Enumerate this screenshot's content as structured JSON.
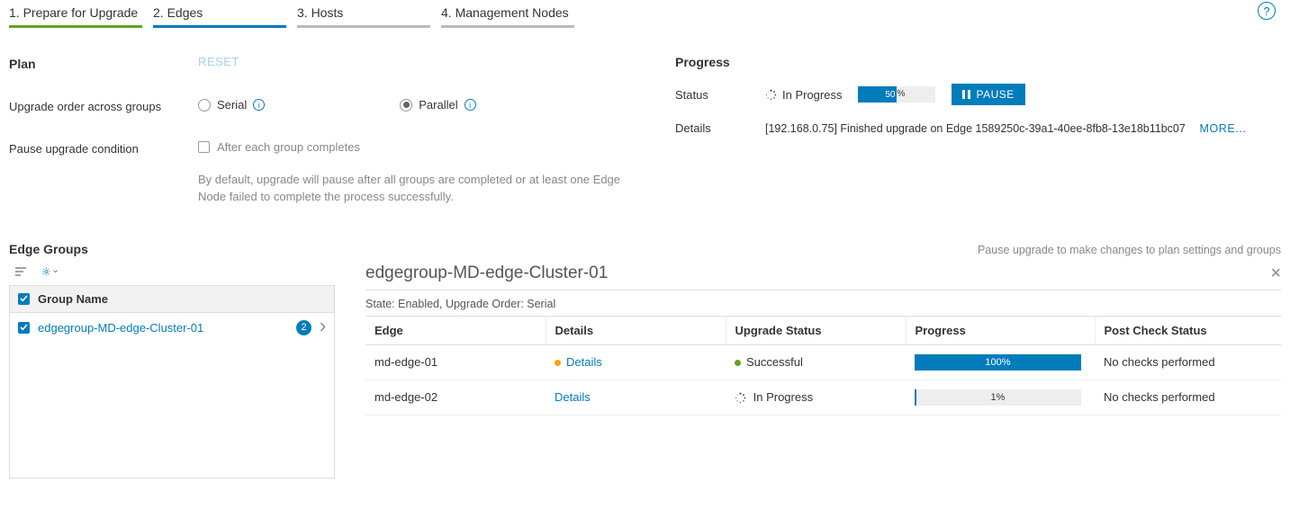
{
  "tabs": [
    {
      "label": "1. Prepare for Upgrade",
      "state": "done"
    },
    {
      "label": "2. Edges",
      "state": "active"
    },
    {
      "label": "3. Hosts",
      "state": ""
    },
    {
      "label": "4. Management Nodes",
      "state": ""
    }
  ],
  "plan": {
    "title": "Plan",
    "reset": "RESET",
    "orderLabel": "Upgrade order across groups",
    "serial": "Serial",
    "parallel": "Parallel",
    "pauseCondLabel": "Pause upgrade condition",
    "pauseOpt": "After each group completes",
    "help": "By default, upgrade will pause after all groups are completed or at least one Edge Node failed to complete the process successfully."
  },
  "progress": {
    "title": "Progress",
    "statusLabel": "Status",
    "statusValue": "In Progress",
    "pct": "50",
    "pauseBtn": "PAUSE",
    "detailsLabel": "Details",
    "detailsText": "[192.168.0.75] Finished upgrade on Edge 1589250c-39a1-40ee-8fb8-13e18b11bc07",
    "more": "MORE..."
  },
  "edgeGroups": {
    "title": "Edge Groups",
    "hint": "Pause upgrade to make changes to plan settings and groups",
    "colHeader": "Group Name",
    "items": [
      {
        "name": "edgegroup-MD-edge-Cluster-01",
        "count": "2"
      }
    ]
  },
  "detail": {
    "title": "edgegroup-MD-edge-Cluster-01",
    "stateLine": "State: Enabled, Upgrade Order: Serial",
    "cols": {
      "edge": "Edge",
      "details": "Details",
      "status": "Upgrade Status",
      "progress": "Progress",
      "post": "Post Check Status"
    },
    "rows": [
      {
        "edge": "md-edge-01",
        "link": "Details",
        "dot": "orange",
        "statusDot": "green",
        "status": "Successful",
        "pct": 100,
        "pctLabel": "100%",
        "post": "No checks performed"
      },
      {
        "edge": "md-edge-02",
        "link": "Details",
        "dot": "",
        "statusDot": "spinner",
        "status": "In Progress",
        "pct": 1,
        "pctLabel": "1%",
        "post": "No checks performed"
      }
    ]
  }
}
